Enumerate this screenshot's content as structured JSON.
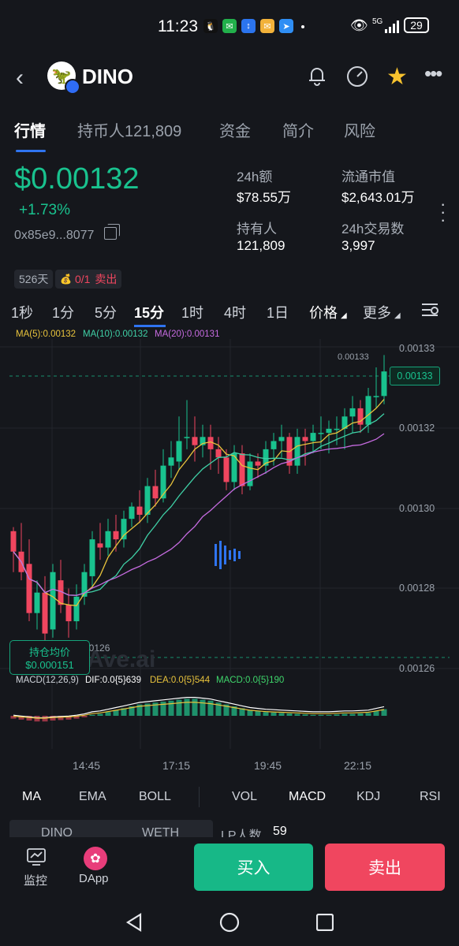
{
  "status": {
    "time": "11:23",
    "signal": "5G",
    "battery": "29"
  },
  "header": {
    "token_name": "DINO"
  },
  "tabs": [
    {
      "label": "行情",
      "active": true
    },
    {
      "label": "持币人121,809",
      "active": false
    },
    {
      "label": "资金",
      "active": false
    },
    {
      "label": "简介",
      "active": false
    },
    {
      "label": "风险",
      "active": false
    }
  ],
  "token": {
    "price": "$0.00132",
    "change": "+1.73%",
    "address": "0x85e9...8077"
  },
  "stats": [
    {
      "label": "24h额",
      "value": "$78.55万"
    },
    {
      "label": "流通市值",
      "value": "$2,643.01万"
    },
    {
      "label": "持有人",
      "value": "121,809"
    },
    {
      "label": "24h交易数",
      "value": "3,997"
    }
  ],
  "pills": {
    "age": "526天",
    "trades_prefix": "0/1",
    "trades_sell": "卖出"
  },
  "intervals": [
    "1秒",
    "1分",
    "5分",
    "15分",
    "1时",
    "4时",
    "1日"
  ],
  "interval_active": "15分",
  "interval_extra": {
    "price": "价格",
    "more": "更多"
  },
  "ma_legend": {
    "ma5": "MA(5):0.00132",
    "ma10": "MA(10):0.00132",
    "ma20": "MA(20):0.00131"
  },
  "macd_legend": {
    "title": "MACD(12,26,9)",
    "dif": "DIF:0.0{5}639",
    "dea": "DEA:0.0{5}544",
    "macd": "MACD:0.0{5}190"
  },
  "chart_data": {
    "type": "candlestick",
    "y_ticks": [
      "0.00133",
      "0.00132",
      "0.00130",
      "0.00128",
      "0.00126"
    ],
    "x_ticks": [
      "14:45",
      "17:15",
      "19:45",
      "22:15"
    ],
    "current_price": "0.00133",
    "high_label": "0.00133",
    "low_label": "0.00126",
    "watermark": "Ave.ai",
    "ylim": [
      0.001258,
      0.001335
    ],
    "candles": [
      [
        0.00129,
        0.001285,
        0.001291,
        0.00128
      ],
      [
        0.001285,
        0.00128,
        0.001292,
        0.001278
      ],
      [
        0.001282,
        0.00127,
        0.001288,
        0.001268
      ],
      [
        0.00127,
        0.001275,
        0.001278,
        0.001266
      ],
      [
        0.001275,
        0.001265,
        0.001279,
        0.001263
      ],
      [
        0.001266,
        0.00128,
        0.001282,
        0.001264
      ],
      [
        0.001278,
        0.001272,
        0.001283,
        0.00127
      ],
      [
        0.001272,
        0.001268,
        0.001276,
        0.001264
      ],
      [
        0.001268,
        0.001274,
        0.001277,
        0.001266
      ],
      [
        0.001274,
        0.00128,
        0.001282,
        0.001272
      ],
      [
        0.001279,
        0.001288,
        0.00129,
        0.001276
      ],
      [
        0.001287,
        0.001286,
        0.001292,
        0.001283
      ],
      [
        0.001286,
        0.00129,
        0.001293,
        0.001284
      ],
      [
        0.00129,
        0.001288,
        0.001294,
        0.001285
      ],
      [
        0.001288,
        0.001293,
        0.001295,
        0.001286
      ],
      [
        0.001293,
        0.001296,
        0.001297,
        0.001291
      ],
      [
        0.001296,
        0.001294,
        0.0013,
        0.001292
      ],
      [
        0.001294,
        0.001301,
        0.001303,
        0.001292
      ],
      [
        0.001301,
        0.001298,
        0.001305,
        0.001296
      ],
      [
        0.001298,
        0.001306,
        0.00131,
        0.001297
      ],
      [
        0.001306,
        0.001308,
        0.001312,
        0.001303
      ],
      [
        0.001307,
        0.001312,
        0.001318,
        0.001305
      ],
      [
        0.001313,
        0.001313,
        0.001322,
        0.00131
      ],
      [
        0.001313,
        0.001311,
        0.001318,
        0.001307
      ],
      [
        0.001311,
        0.001313,
        0.001316,
        0.001308
      ],
      [
        0.001313,
        0.00131,
        0.001316,
        0.001305
      ],
      [
        0.00131,
        0.001308,
        0.001313,
        0.001304
      ],
      [
        0.001308,
        0.001302,
        0.00131,
        0.0013
      ],
      [
        0.001302,
        0.001309,
        0.001311,
        0.0013
      ],
      [
        0.001309,
        0.001301,
        0.001311,
        0.001299
      ],
      [
        0.001301,
        0.001307,
        0.001309,
        0.0013
      ],
      [
        0.001307,
        0.001306,
        0.001309,
        0.001303
      ],
      [
        0.001306,
        0.00131,
        0.001312,
        0.001304
      ],
      [
        0.00131,
        0.001312,
        0.001314,
        0.001306
      ],
      [
        0.001312,
        0.001313,
        0.001316,
        0.001308
      ],
      [
        0.001313,
        0.001306,
        0.001314,
        0.001304
      ],
      [
        0.001306,
        0.001313,
        0.001315,
        0.001304
      ],
      [
        0.001313,
        0.001312,
        0.001315,
        0.001306
      ],
      [
        0.001312,
        0.001314,
        0.001316,
        0.001309
      ],
      [
        0.001314,
        0.001314,
        0.001318,
        0.00131
      ],
      [
        0.001314,
        0.001315,
        0.001317,
        0.001309
      ],
      [
        0.001315,
        0.001315,
        0.001318,
        0.001311
      ],
      [
        0.001315,
        0.001318,
        0.00132,
        0.00131
      ],
      [
        0.001318,
        0.00132,
        0.001323,
        0.001314
      ],
      [
        0.00132,
        0.001316,
        0.001322,
        0.001314
      ],
      [
        0.001316,
        0.001323,
        0.001325,
        0.001314
      ],
      [
        0.001323,
        0.001323,
        0.00133,
        0.00132
      ],
      [
        0.001323,
        0.001329,
        0.001333,
        0.001321
      ]
    ],
    "macd_hist": [
      -0.3,
      -0.4,
      -0.5,
      -0.6,
      -0.6,
      -0.5,
      -0.45,
      -0.4,
      -0.3,
      -0.15,
      0.1,
      0.2,
      0.4,
      0.6,
      0.8,
      1.0,
      1.2,
      1.3,
      1.4,
      1.5,
      1.6,
      1.7,
      1.8,
      1.8,
      1.7,
      1.6,
      1.4,
      1.2,
      1.0,
      0.8,
      0.6,
      0.5,
      0.4,
      0.35,
      0.3,
      0.25,
      0.2,
      0.15,
      0.1,
      0.1,
      0.1,
      0.15,
      0.2,
      0.2,
      0.25,
      0.3,
      0.5,
      0.7
    ]
  },
  "entry_marker": {
    "label": "持仓均价",
    "value": "$0.000151"
  },
  "indicator_tabs": [
    "MA",
    "EMA",
    "BOLL",
    "VOL",
    "MACD",
    "KDJ",
    "RSI"
  ],
  "lp_row": {
    "left": "DINO",
    "right": "WETH",
    "lp_label": "LP人数",
    "lp_value": "59"
  },
  "bottom": {
    "monitor": "监控",
    "dapp": "DApp",
    "buy": "买入",
    "sell": "卖出"
  },
  "colors": {
    "up": "#19c28e",
    "down": "#f0465f",
    "ma5": "#e8c33c",
    "ma10": "#3fd0a6",
    "ma20": "#c66be0",
    "accent": "#2f74f0"
  }
}
